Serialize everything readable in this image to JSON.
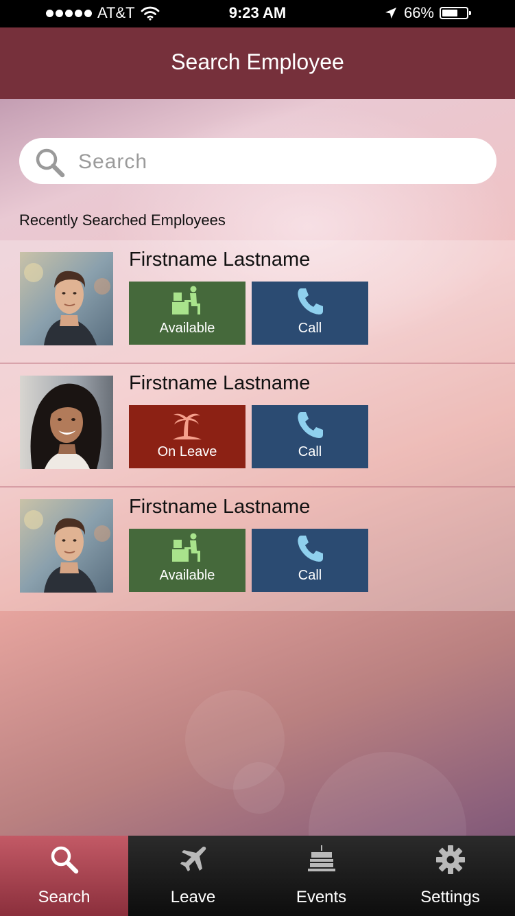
{
  "status_bar": {
    "carrier": "AT&T",
    "time": "9:23 AM",
    "battery": "66%",
    "battery_level": 0.66,
    "icons": [
      "signal-dots-icon",
      "wifi-icon",
      "location-arrow-icon",
      "battery-icon"
    ]
  },
  "nav": {
    "title": "Search Employee"
  },
  "search": {
    "placeholder": "Search",
    "value": "",
    "icon": "search-icon"
  },
  "section": {
    "label": "Recently Searched Employees"
  },
  "employees": [
    {
      "name": "Firstname Lastname",
      "status_label": "Available",
      "status_icon": "desk-worker-icon",
      "call_label": "Call",
      "call_icon": "phone-icon",
      "avatar": "male-avatar"
    },
    {
      "name": "Firstname Lastname",
      "status_label": "On Leave",
      "status_icon": "palm-tree-icon",
      "call_label": "Call",
      "call_icon": "phone-icon",
      "avatar": "female-avatar"
    },
    {
      "name": "Firstname Lastname",
      "status_label": "Available",
      "status_icon": "desk-worker-icon",
      "call_label": "Call",
      "call_icon": "phone-icon",
      "avatar": "male-avatar"
    }
  ],
  "tabs": [
    {
      "label": "Search",
      "icon": "search-icon",
      "active": true
    },
    {
      "label": "Leave",
      "icon": "airplane-icon",
      "active": false
    },
    {
      "label": "Events",
      "icon": "cake-icon",
      "active": false
    },
    {
      "label": "Settings",
      "icon": "gear-icon",
      "active": false
    }
  ],
  "colors": {
    "nav_bar": "#76303b",
    "available": "#45693b",
    "on_leave": "#8c2114",
    "call": "#2b4b72",
    "available_icon": "#a9e38c",
    "on_leave_icon": "#f5a08c",
    "call_icon": "#8fd0ee",
    "tab_active": "#b14a57",
    "tab_bar": "#1a1a1a"
  }
}
